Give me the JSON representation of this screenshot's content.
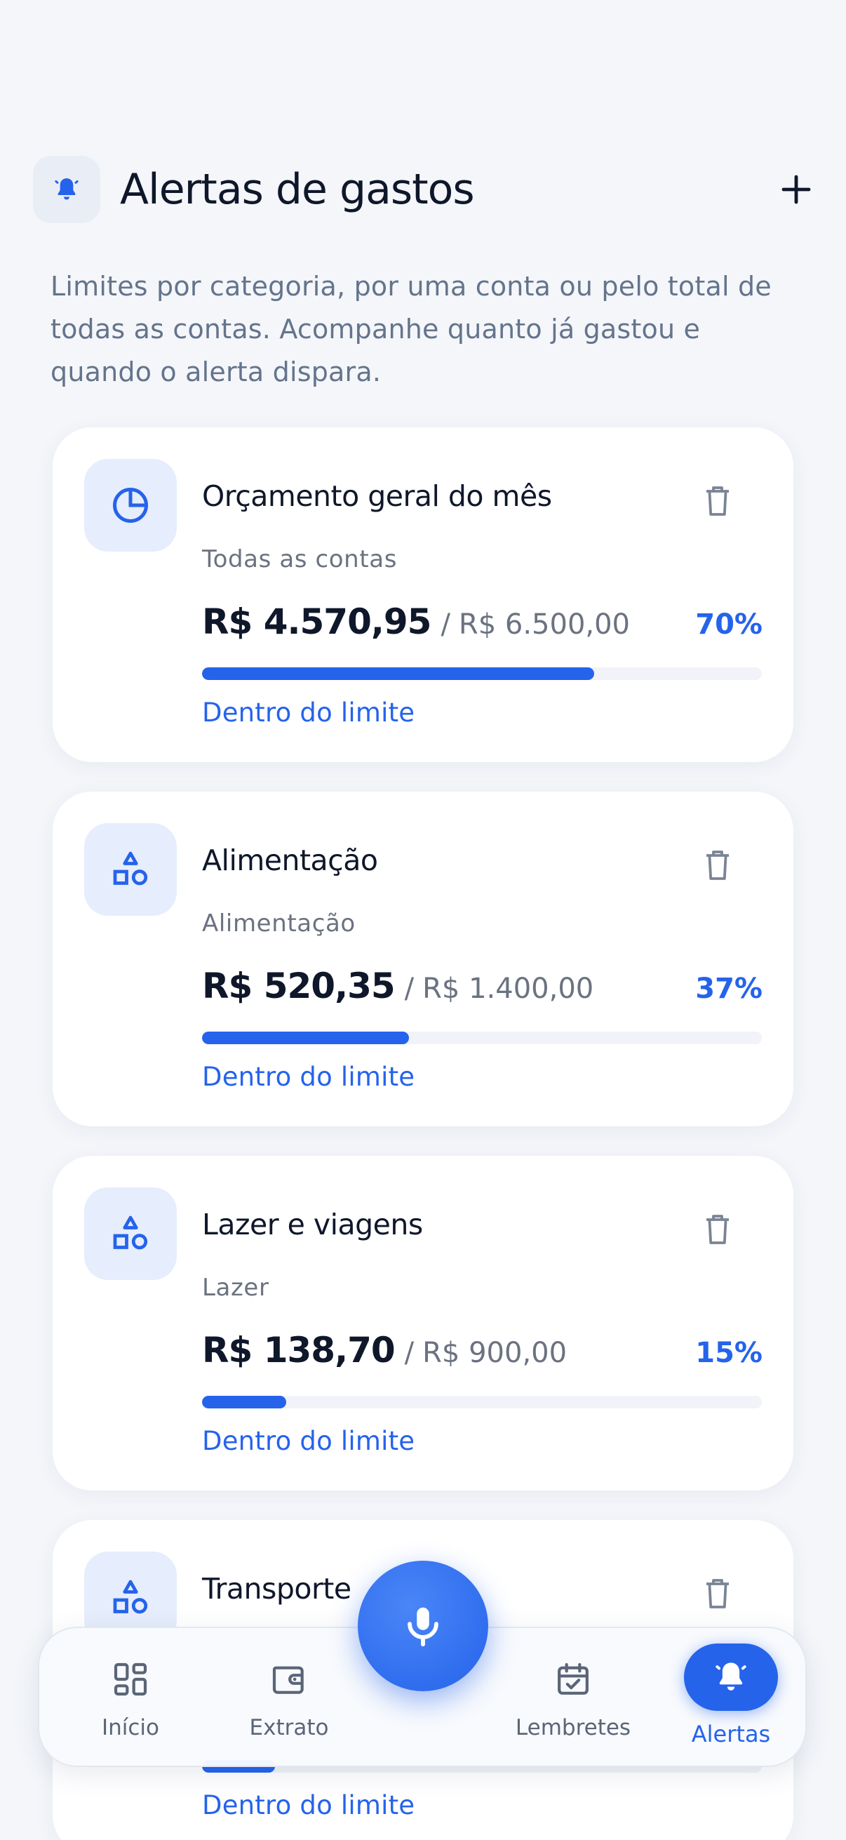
{
  "header": {
    "title": "Alertas de gastos",
    "intro": "Limites por categoria, por uma conta ou pelo total de todas as contas. Acompanhe quanto já gastou e quando o alerta dispara."
  },
  "colors": {
    "accent": "#2563eb",
    "background": "#f4f6fa",
    "card": "#ffffff",
    "icon_tile": "#e6edfc"
  },
  "alerts": [
    {
      "icon": "pie-chart-icon",
      "title": "Orçamento geral do mês",
      "subtitle": "Todas as contas",
      "spent": "R$ 4.570,95",
      "sep": "/",
      "limit": "R$ 6.500,00",
      "percent": "70%",
      "progress": 0.7,
      "status": "Dentro do limite"
    },
    {
      "icon": "shapes-icon",
      "title": "Alimentação",
      "subtitle": "Alimentação",
      "spent": "R$ 520,35",
      "sep": "/",
      "limit": "R$ 1.400,00",
      "percent": "37%",
      "progress": 0.37,
      "status": "Dentro do limite"
    },
    {
      "icon": "shapes-icon",
      "title": "Lazer e viagens",
      "subtitle": "Lazer",
      "spent": "R$ 138,70",
      "sep": "/",
      "limit": "R$ 900,00",
      "percent": "15%",
      "progress": 0.15,
      "status": "Dentro do limite"
    },
    {
      "icon": "shapes-icon",
      "title": "Transporte",
      "status": "Dentro do limite"
    }
  ],
  "nav": {
    "items": [
      {
        "label": "Início",
        "icon": "dashboard-icon"
      },
      {
        "label": "Extrato",
        "icon": "wallet-icon"
      },
      {
        "label": "Lembretes",
        "icon": "calendar-check-icon"
      },
      {
        "label": "Alertas",
        "icon": "bell-icon",
        "active": true
      }
    ],
    "mic": "microphone-icon"
  }
}
